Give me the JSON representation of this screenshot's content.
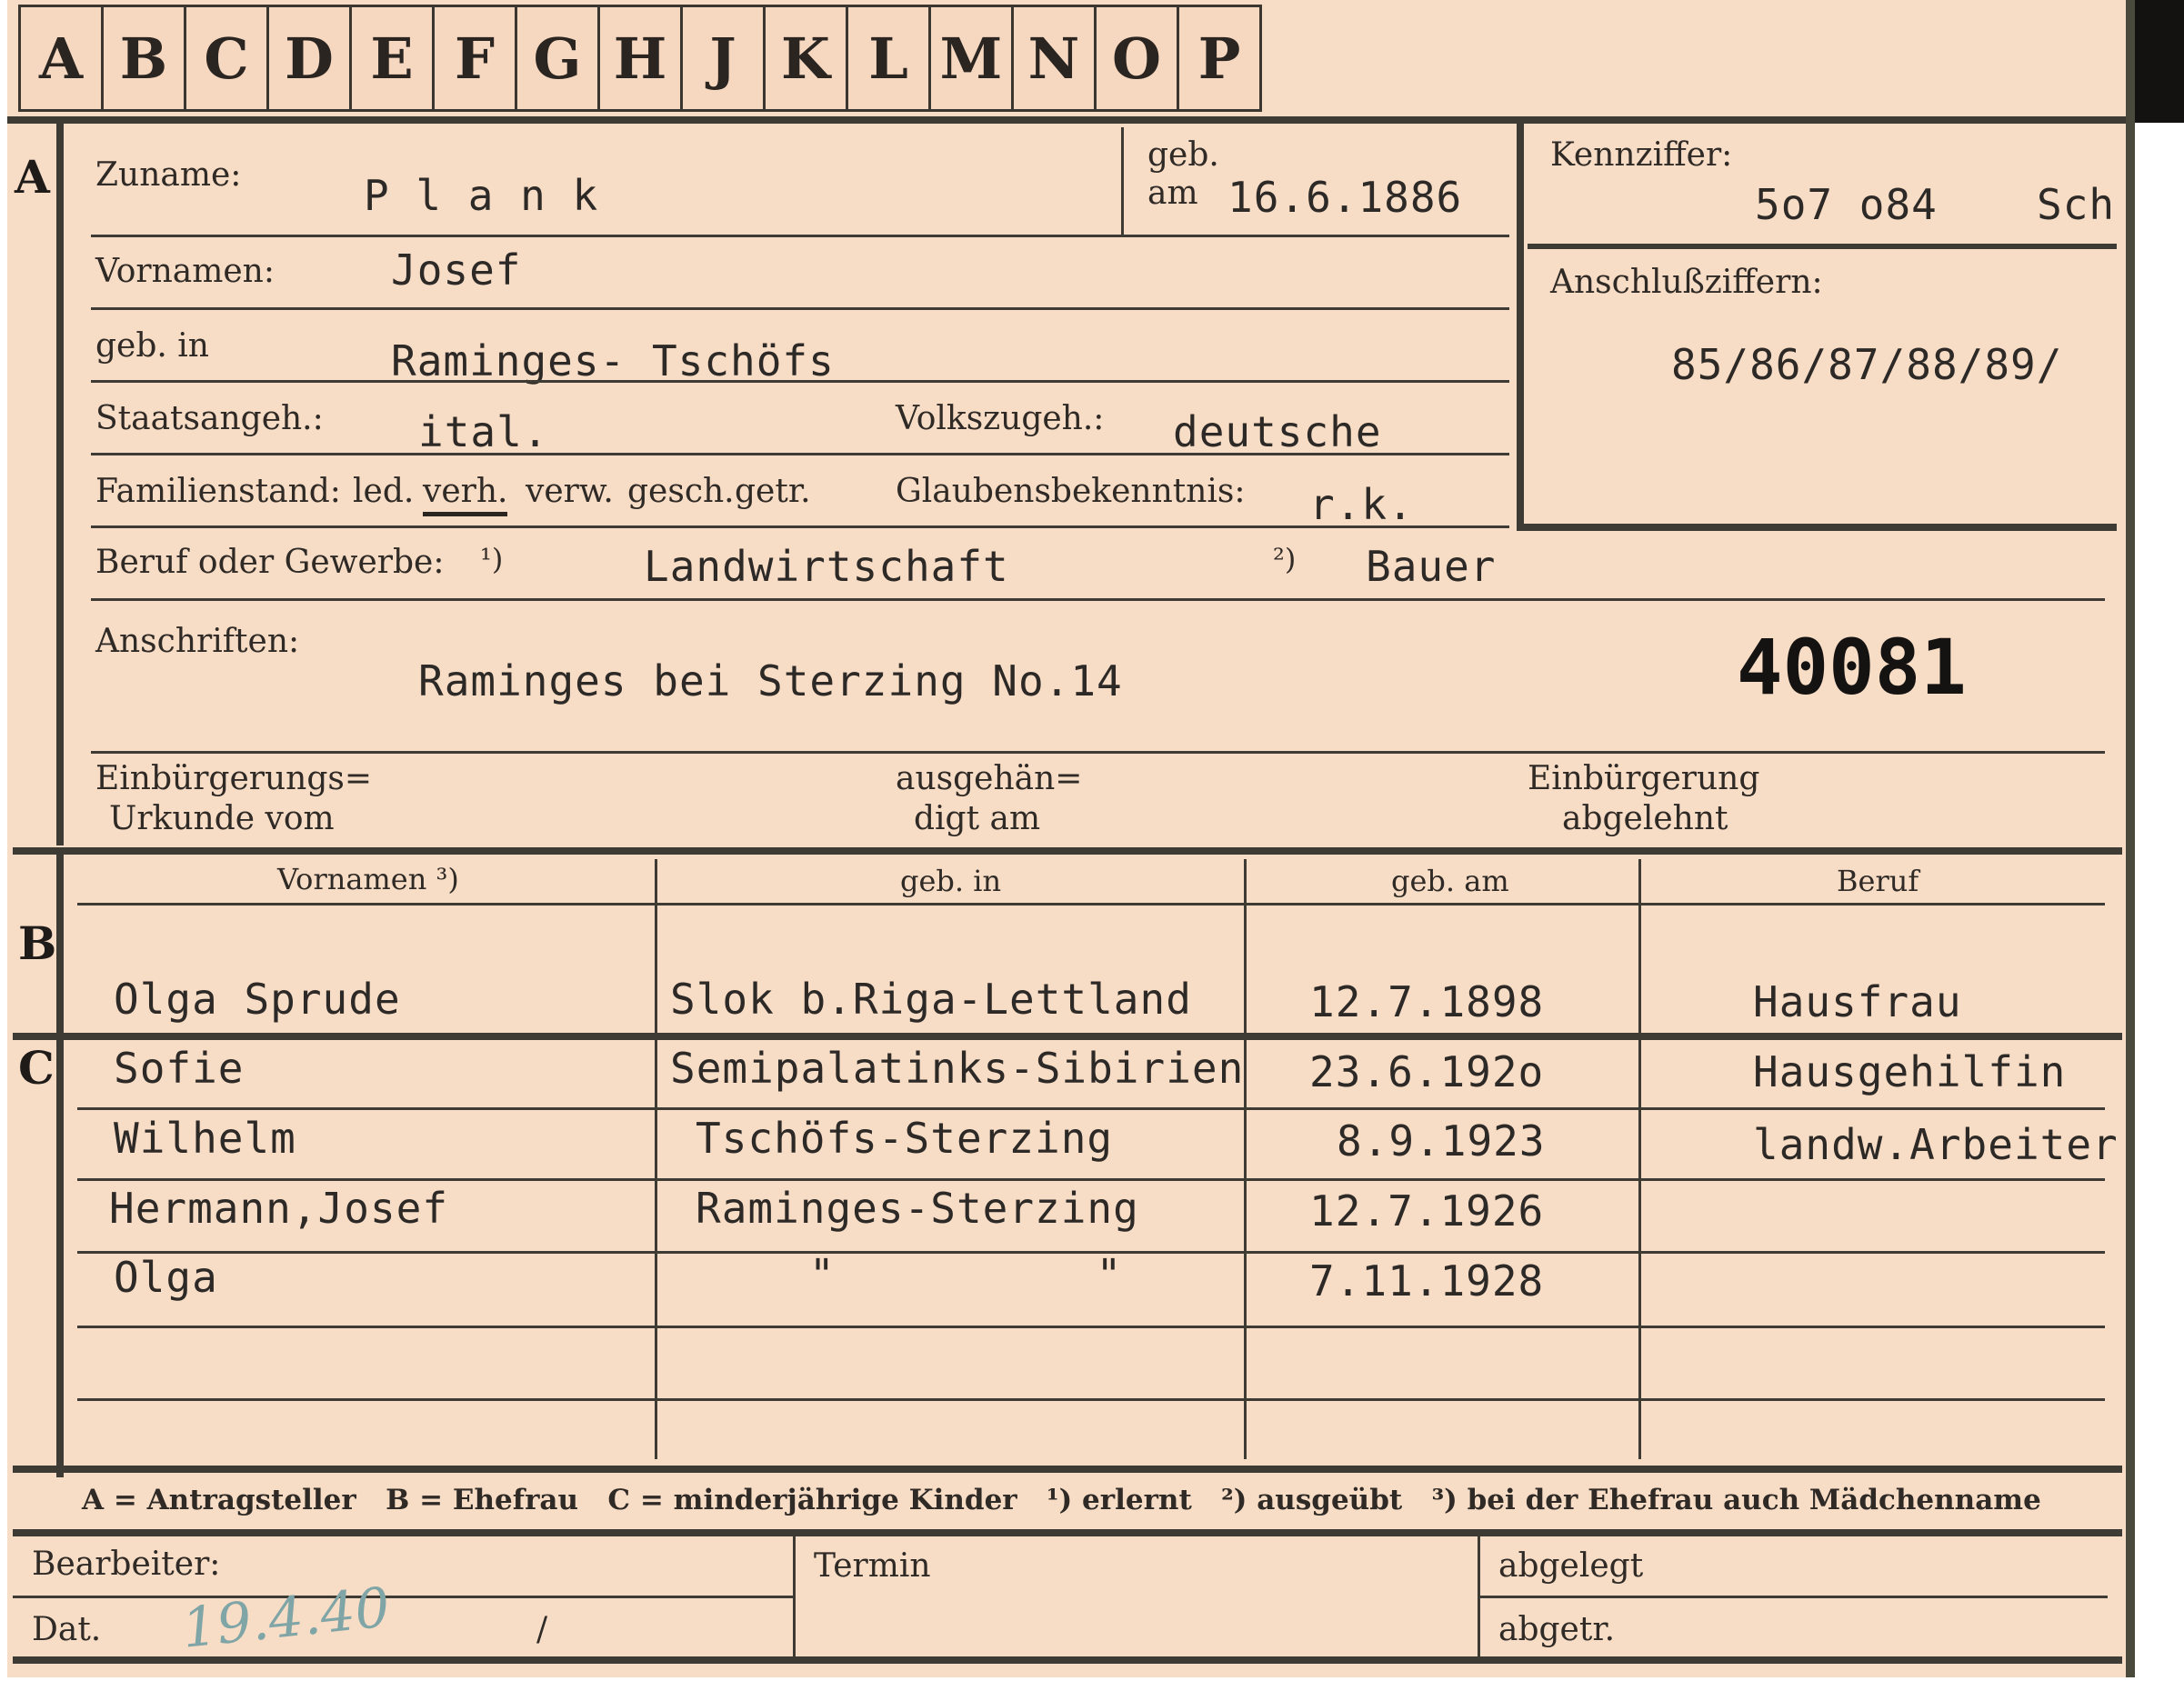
{
  "tabs": [
    "A",
    "B",
    "C",
    "D",
    "E",
    "F",
    "G",
    "H",
    "J",
    "K",
    "L",
    "M",
    "N",
    "O",
    "P"
  ],
  "section_a": {
    "letter": "A",
    "zuname_label": "Zuname:",
    "zuname_value": "P l a n k",
    "geb_am_label_1": "geb.",
    "geb_am_label_2": "am",
    "geb_am_value": "16.6.1886",
    "vornamen_label": "Vornamen:",
    "vornamen_value": "Josef",
    "geb_in_label": "geb. in",
    "geb_in_value": "Raminges- Tschöfs",
    "staatsangeh_label": "Staatsangeh.:",
    "staatsangeh_value": "ital.",
    "volkszugeh_label": "Volkszugeh.:",
    "volkszugeh_value": "deutsche",
    "familienstand_label": "Familienstand:",
    "familienstand_options": [
      "led.",
      "verh.",
      "verw.",
      "gesch.",
      "getr."
    ],
    "familienstand_selected": "verh.",
    "glauben_label": "Glaubensbekenntnis:",
    "glauben_value": "r.k.",
    "beruf_label": "Beruf oder Gewerbe:",
    "beruf_mark1": "¹)",
    "beruf_value1": "Landwirtschaft",
    "beruf_mark2": "²)",
    "beruf_value2": "Bauer",
    "anschriften_label": "Anschriften:",
    "anschriften_value": "Raminges  bei Sterzing No.14",
    "stamp_number": "40081",
    "einbuerg_urkunde_1": "Einbürgerungs=",
    "einbuerg_urkunde_2": "Urkunde vom",
    "ausgehaendigt_1": "ausgehän=",
    "ausgehaendigt_2": "digt am",
    "einbuerg_abgelehnt_1": "Einbürgerung",
    "einbuerg_abgelehnt_2": "abgelehnt"
  },
  "kennziffer": {
    "label": "Kennziffer:",
    "value": "5o7 o84",
    "suffix": "Sch"
  },
  "anschlussziffern": {
    "label": "Anschlußziffern:",
    "value": "85/86/87/88/89/"
  },
  "section_b": {
    "letter": "B",
    "columns": [
      "Vornamen ³)",
      "geb. in",
      "geb. am",
      "Beruf"
    ],
    "row": {
      "vornamen": "Olga  Sprude",
      "geb_in": "Slok b.Riga-Lettland",
      "geb_am": "12.7.1898",
      "beruf": "Hausfrau"
    }
  },
  "section_c": {
    "letter": "C",
    "rows": [
      {
        "vornamen": "Sofie",
        "geb_in": "Semipalatinks-Sibirien",
        "geb_am": "23.6.192o",
        "beruf": "Hausgehilfin"
      },
      {
        "vornamen": "Wilhelm",
        "geb_in": "Tschöfs-Sterzing",
        "geb_am": "8.9.1923",
        "beruf": "landw.Arbeiter"
      },
      {
        "vornamen": "Hermann,Josef",
        "geb_in": "Raminges-Sterzing",
        "geb_am": "12.7.1926",
        "beruf": ""
      },
      {
        "vornamen": "Olga",
        "geb_in": "\"          \"",
        "geb_am": "7.11.1928",
        "beruf": ""
      }
    ]
  },
  "legend": "A = Antragsteller   B = Ehefrau   C = minderjährige Kinder   ¹) erlernt   ²) ausgeübt   ³) bei der Ehefrau auch Mädchenname",
  "footer": {
    "bearbeiter_label": "Bearbeiter:",
    "dat_label": "Dat.",
    "dat_value": "19.4.40",
    "dat_slash": "/",
    "termin_label": "Termin",
    "abgelegt_label": "abgelegt",
    "abgetr_label": "abgetr."
  }
}
